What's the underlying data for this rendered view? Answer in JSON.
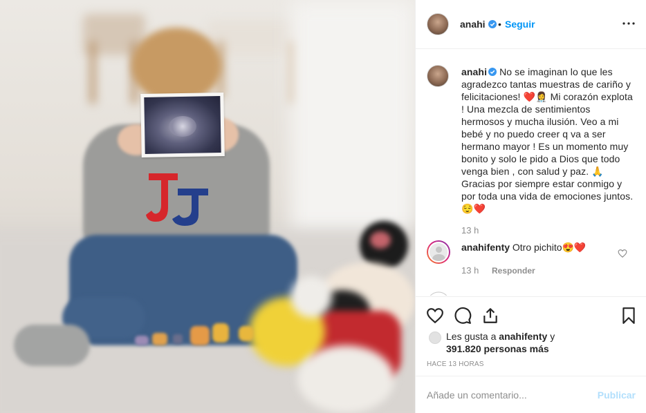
{
  "post": {
    "username": "anahi",
    "follow_label": "Seguir",
    "dot": "•",
    "caption_text": "No se imaginan lo que les agradezco tantas muestras de cariño y felicitaciones! ❤️👩‍⚕️ Mi corazón explota ! Una mezcla de sentimientos hermosos y mucha ilusión. Veo a mi bebé y no puedo creer q va a ser hermano mayor ! Es un momento muy bonito y solo le pido a Dios que todo venga bien , con salud y paz. 🙏 Gracias por siempre estar conmigo y por toda una vida de emociones juntos. 😌❤️",
    "caption_time": "13 h"
  },
  "comments": [
    {
      "username": "anahifenty",
      "text": "Otro pichito😍❤️",
      "time": "13 h",
      "reply_label": "Responder"
    }
  ],
  "likes": {
    "prefix": "Les gusta a",
    "first_user": "anahifenty",
    "connector": "y",
    "others": "391.820 personas más"
  },
  "post_time": "HACE 13 HORAS",
  "add_comment": {
    "placeholder": "Añade un comentario...",
    "publish_label": "Publicar"
  },
  "icons": {
    "verified": "verified-badge-icon",
    "more": "more-options-icon",
    "like": "heart-icon",
    "comment": "comment-bubble-icon",
    "share": "share-icon",
    "save": "bookmark-icon"
  },
  "colors": {
    "accent": "#0095f6",
    "publish_disabled": "#b2dffc",
    "like_red": "#ed4956",
    "muted": "#8e8e8e"
  }
}
